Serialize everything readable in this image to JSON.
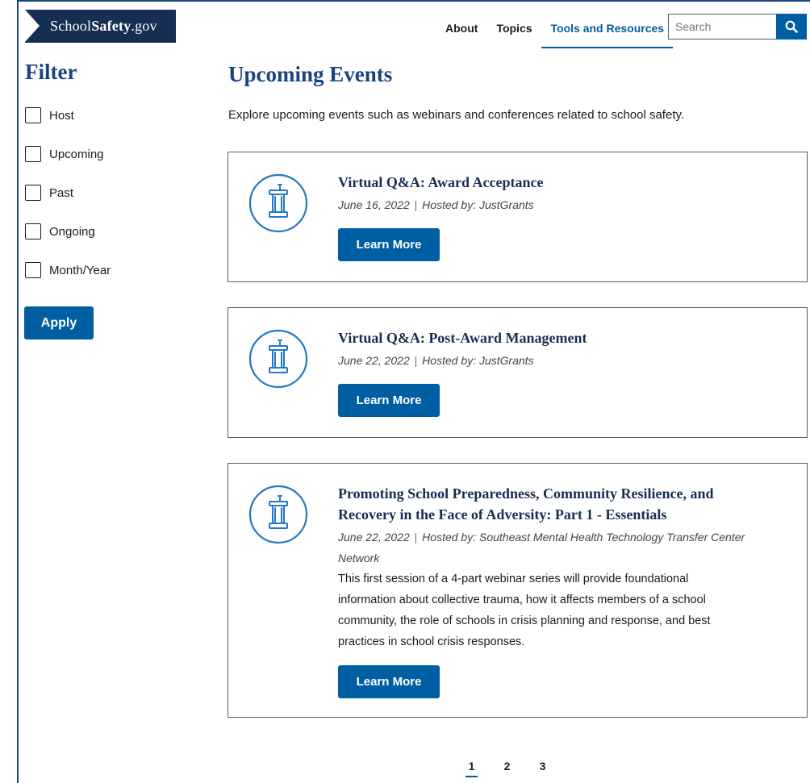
{
  "header": {
    "logo": {
      "prefix": "School",
      "bold": "Safety",
      "suffix": ".gov"
    },
    "nav": [
      {
        "label": "About",
        "active": false
      },
      {
        "label": "Topics",
        "active": false
      },
      {
        "label": "Tools and Resources",
        "active": true
      }
    ],
    "search": {
      "placeholder": "Search",
      "value": ""
    }
  },
  "sidebar": {
    "title": "Filter",
    "filters": [
      "Host",
      "Upcoming",
      "Past",
      "Ongoing",
      "Month/Year"
    ],
    "apply_label": "Apply"
  },
  "main": {
    "title": "Upcoming Events",
    "intro": "Explore upcoming events such as webinars and conferences related to school safety.",
    "events": [
      {
        "title": "Virtual Q&A: Award Acceptance",
        "date": "June 16, 2022",
        "separator": "|",
        "host": "Hosted by: JustGrants",
        "host_cont": "",
        "description": "",
        "button": "Learn More"
      },
      {
        "title": "Virtual Q&A: Post-Award Management",
        "date": "June 22, 2022",
        "separator": "|",
        "host": "Hosted by: JustGrants",
        "host_cont": "",
        "description": "",
        "button": "Learn More"
      },
      {
        "title": "Promoting School Preparedness, Community Resilience, and Recovery in the Face of Adversity: Part 1 - Essentials",
        "date": "June 22, 2022",
        "separator": "|",
        "host": "Hosted by: Southeast Mental Health Technology Transfer",
        "host_cont": "Center Network",
        "description": "This first session of a 4-part webinar series will provide foundational information about collective trauma, how it affects members of a school community, the role of schools in crisis planning and response, and best practices in school crisis responses.",
        "button": "Learn More"
      }
    ],
    "event_icon": "podium-icon"
  },
  "pagination": {
    "pages": [
      "1",
      "2",
      "3"
    ],
    "current": "1"
  },
  "colors": {
    "primary": "#005ea2",
    "navy": "#162e51",
    "heading": "#1a4480",
    "icon": "#2378c3"
  }
}
